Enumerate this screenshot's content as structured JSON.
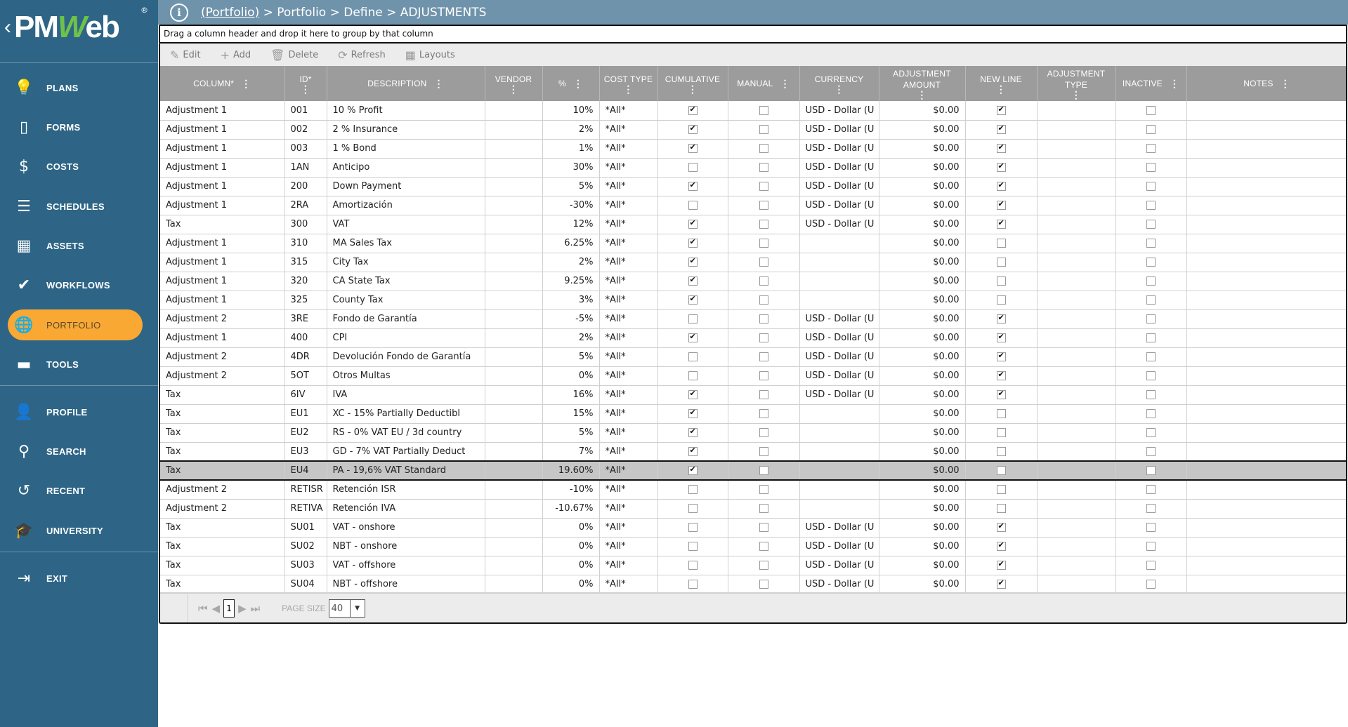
{
  "app": {
    "logo_text_pm": "PM",
    "logo_text_w": "W",
    "logo_text_eb": "eb",
    "logo_reg": "®",
    "logo_chevron": "‹"
  },
  "sidebar": {
    "items": [
      {
        "label": "PLANS",
        "icon": "lightbulb-icon",
        "glyph": "💡"
      },
      {
        "label": "FORMS",
        "icon": "document-icon",
        "glyph": "▯"
      },
      {
        "label": "COSTS",
        "icon": "dollar-icon",
        "glyph": "$"
      },
      {
        "label": "SCHEDULES",
        "icon": "gantt-icon",
        "glyph": "☰"
      },
      {
        "label": "ASSETS",
        "icon": "building-icon",
        "glyph": "▦"
      },
      {
        "label": "WORKFLOWS",
        "icon": "checkmark-icon",
        "glyph": "✔"
      },
      {
        "label": "PORTFOLIO",
        "icon": "globe-icon",
        "glyph": "🌐",
        "active": true
      },
      {
        "label": "TOOLS",
        "icon": "toolbox-icon",
        "glyph": "▬"
      },
      {
        "label": "PROFILE",
        "icon": "user-icon",
        "glyph": "👤"
      },
      {
        "label": "SEARCH",
        "icon": "search-icon",
        "glyph": "⚲"
      },
      {
        "label": "RECENT",
        "icon": "history-icon",
        "glyph": "↺"
      },
      {
        "label": "UNIVERSITY",
        "icon": "graduation-cap-icon",
        "glyph": "🎓"
      },
      {
        "label": "EXIT",
        "icon": "exit-icon",
        "glyph": "⇥"
      }
    ]
  },
  "header": {
    "info_glyph": "i",
    "breadcrumb_link": "(Portfolio)",
    "breadcrumb_rest": " > Portfolio > Define > ADJUSTMENTS"
  },
  "groupbar": {
    "text": "Drag a column header and drop it here to group by that column"
  },
  "toolbar": {
    "edit_label": "Edit",
    "add_label": "Add",
    "delete_label": "Delete",
    "refresh_label": "Refresh",
    "layouts_label": "Layouts"
  },
  "grid": {
    "columns": [
      {
        "label": "COLUMN*"
      },
      {
        "label": "ID*"
      },
      {
        "label": "DESCRIPTION"
      },
      {
        "label": "VENDOR"
      },
      {
        "label": "%"
      },
      {
        "label": "COST TYPE"
      },
      {
        "label": "CUMULATIVE"
      },
      {
        "label": "MANUAL"
      },
      {
        "label": "CURRENCY"
      },
      {
        "label": "ADJUSTMENT AMOUNT"
      },
      {
        "label": "NEW LINE"
      },
      {
        "label": "ADJUSTMENT TYPE"
      },
      {
        "label": "INACTIVE"
      },
      {
        "label": "NOTES"
      }
    ],
    "rows": [
      {
        "column": "Adjustment 1",
        "id": "001",
        "description": "10 % Profit",
        "vendor": "",
        "percent": "10%",
        "cost_type": "*All*",
        "cumulative": true,
        "manual": false,
        "currency": "USD - Dollar (U",
        "amount": "$0.00",
        "new_line": true,
        "adj_type": "",
        "inactive": false,
        "notes": ""
      },
      {
        "column": "Adjustment 1",
        "id": "002",
        "description": "2 % Insurance",
        "vendor": "",
        "percent": "2%",
        "cost_type": "*All*",
        "cumulative": true,
        "manual": false,
        "currency": "USD - Dollar (U",
        "amount": "$0.00",
        "new_line": true,
        "adj_type": "",
        "inactive": false,
        "notes": ""
      },
      {
        "column": "Adjustment 1",
        "id": "003",
        "description": "1 % Bond",
        "vendor": "",
        "percent": "1%",
        "cost_type": "*All*",
        "cumulative": true,
        "manual": false,
        "currency": "USD - Dollar (U",
        "amount": "$0.00",
        "new_line": true,
        "adj_type": "",
        "inactive": false,
        "notes": ""
      },
      {
        "column": "Adjustment 1",
        "id": "1AN",
        "description": "Anticipo",
        "vendor": "",
        "percent": "30%",
        "cost_type": "*All*",
        "cumulative": false,
        "manual": false,
        "currency": "USD - Dollar (U",
        "amount": "$0.00",
        "new_line": true,
        "adj_type": "",
        "inactive": false,
        "notes": ""
      },
      {
        "column": "Adjustment 1",
        "id": "200",
        "description": "Down Payment",
        "vendor": "",
        "percent": "5%",
        "cost_type": "*All*",
        "cumulative": true,
        "manual": false,
        "currency": "USD - Dollar (U",
        "amount": "$0.00",
        "new_line": true,
        "adj_type": "",
        "inactive": false,
        "notes": ""
      },
      {
        "column": "Adjustment 1",
        "id": "2RA",
        "description": "Amortización",
        "vendor": "",
        "percent": "-30%",
        "cost_type": "*All*",
        "cumulative": false,
        "manual": false,
        "currency": "USD - Dollar (U",
        "amount": "$0.00",
        "new_line": true,
        "adj_type": "",
        "inactive": false,
        "notes": ""
      },
      {
        "column": "Tax",
        "id": "300",
        "description": "VAT",
        "vendor": "",
        "percent": "12%",
        "cost_type": "*All*",
        "cumulative": true,
        "manual": false,
        "currency": "USD - Dollar (U",
        "amount": "$0.00",
        "new_line": true,
        "adj_type": "",
        "inactive": false,
        "notes": ""
      },
      {
        "column": "Adjustment 1",
        "id": "310",
        "description": "MA Sales Tax",
        "vendor": "",
        "percent": "6.25%",
        "cost_type": "*All*",
        "cumulative": true,
        "manual": false,
        "currency": "",
        "amount": "$0.00",
        "new_line": false,
        "adj_type": "",
        "inactive": false,
        "notes": ""
      },
      {
        "column": "Adjustment 1",
        "id": "315",
        "description": "City Tax",
        "vendor": "",
        "percent": "2%",
        "cost_type": "*All*",
        "cumulative": true,
        "manual": false,
        "currency": "",
        "amount": "$0.00",
        "new_line": false,
        "adj_type": "",
        "inactive": false,
        "notes": ""
      },
      {
        "column": "Adjustment 1",
        "id": "320",
        "description": "CA State Tax",
        "vendor": "",
        "percent": "9.25%",
        "cost_type": "*All*",
        "cumulative": true,
        "manual": false,
        "currency": "",
        "amount": "$0.00",
        "new_line": false,
        "adj_type": "",
        "inactive": false,
        "notes": ""
      },
      {
        "column": "Adjustment 1",
        "id": "325",
        "description": "County Tax",
        "vendor": "",
        "percent": "3%",
        "cost_type": "*All*",
        "cumulative": true,
        "manual": false,
        "currency": "",
        "amount": "$0.00",
        "new_line": false,
        "adj_type": "",
        "inactive": false,
        "notes": ""
      },
      {
        "column": "Adjustment 2",
        "id": "3RE",
        "description": "Fondo de Garantía",
        "vendor": "",
        "percent": "-5%",
        "cost_type": "*All*",
        "cumulative": false,
        "manual": false,
        "currency": "USD - Dollar (U",
        "amount": "$0.00",
        "new_line": true,
        "adj_type": "",
        "inactive": false,
        "notes": ""
      },
      {
        "column": "Adjustment 1",
        "id": "400",
        "description": "CPI",
        "vendor": "",
        "percent": "2%",
        "cost_type": "*All*",
        "cumulative": true,
        "manual": false,
        "currency": "USD - Dollar (U",
        "amount": "$0.00",
        "new_line": true,
        "adj_type": "",
        "inactive": false,
        "notes": ""
      },
      {
        "column": "Adjustment 2",
        "id": "4DR",
        "description": "Devolución Fondo de Garantía",
        "vendor": "",
        "percent": "5%",
        "cost_type": "*All*",
        "cumulative": false,
        "manual": false,
        "currency": "USD - Dollar (U",
        "amount": "$0.00",
        "new_line": true,
        "adj_type": "",
        "inactive": false,
        "notes": ""
      },
      {
        "column": "Adjustment 2",
        "id": "5OT",
        "description": "Otros Multas",
        "vendor": "",
        "percent": "0%",
        "cost_type": "*All*",
        "cumulative": false,
        "manual": false,
        "currency": "USD - Dollar (U",
        "amount": "$0.00",
        "new_line": true,
        "adj_type": "",
        "inactive": false,
        "notes": ""
      },
      {
        "column": "Tax",
        "id": "6IV",
        "description": "IVA",
        "vendor": "",
        "percent": "16%",
        "cost_type": "*All*",
        "cumulative": true,
        "manual": false,
        "currency": "USD - Dollar (U",
        "amount": "$0.00",
        "new_line": true,
        "adj_type": "",
        "inactive": false,
        "notes": ""
      },
      {
        "column": "Tax",
        "id": "EU1",
        "description": "XC - 15% Partially Deductibl",
        "vendor": "",
        "percent": "15%",
        "cost_type": "*All*",
        "cumulative": true,
        "manual": false,
        "currency": "",
        "amount": "$0.00",
        "new_line": false,
        "adj_type": "",
        "inactive": false,
        "notes": ""
      },
      {
        "column": "Tax",
        "id": "EU2",
        "description": "RS - 0% VAT EU / 3d country",
        "vendor": "",
        "percent": "5%",
        "cost_type": "*All*",
        "cumulative": true,
        "manual": false,
        "currency": "",
        "amount": "$0.00",
        "new_line": false,
        "adj_type": "",
        "inactive": false,
        "notes": ""
      },
      {
        "column": "Tax",
        "id": "EU3",
        "description": "GD - 7% VAT Partially Deduct",
        "vendor": "",
        "percent": "7%",
        "cost_type": "*All*",
        "cumulative": true,
        "manual": false,
        "currency": "",
        "amount": "$0.00",
        "new_line": false,
        "adj_type": "",
        "inactive": false,
        "notes": ""
      },
      {
        "column": "Tax",
        "id": "EU4",
        "description": "PA - 19,6% VAT Standard",
        "vendor": "",
        "percent": "19.60%",
        "cost_type": "*All*",
        "cumulative": true,
        "manual": false,
        "currency": "",
        "amount": "$0.00",
        "new_line": false,
        "adj_type": "",
        "inactive": false,
        "notes": "",
        "selected": true
      },
      {
        "column": "Adjustment 2",
        "id": "RETISR",
        "description": "Retención ISR",
        "vendor": "",
        "percent": "-10%",
        "cost_type": "*All*",
        "cumulative": false,
        "manual": false,
        "currency": "",
        "amount": "$0.00",
        "new_line": false,
        "adj_type": "",
        "inactive": false,
        "notes": ""
      },
      {
        "column": "Adjustment 2",
        "id": "RETIVA",
        "description": "Retención IVA",
        "vendor": "",
        "percent": "-10.67%",
        "cost_type": "*All*",
        "cumulative": false,
        "manual": false,
        "currency": "",
        "amount": "$0.00",
        "new_line": false,
        "adj_type": "",
        "inactive": false,
        "notes": ""
      },
      {
        "column": "Tax",
        "id": "SU01",
        "description": "VAT - onshore",
        "vendor": "",
        "percent": "0%",
        "cost_type": "*All*",
        "cumulative": false,
        "manual": false,
        "currency": "USD - Dollar (U",
        "amount": "$0.00",
        "new_line": true,
        "adj_type": "",
        "inactive": false,
        "notes": ""
      },
      {
        "column": "Tax",
        "id": "SU02",
        "description": "NBT - onshore",
        "vendor": "",
        "percent": "0%",
        "cost_type": "*All*",
        "cumulative": false,
        "manual": false,
        "currency": "USD - Dollar (U",
        "amount": "$0.00",
        "new_line": true,
        "adj_type": "",
        "inactive": false,
        "notes": ""
      },
      {
        "column": "Tax",
        "id": "SU03",
        "description": "VAT - offshore",
        "vendor": "",
        "percent": "0%",
        "cost_type": "*All*",
        "cumulative": false,
        "manual": false,
        "currency": "USD - Dollar (U",
        "amount": "$0.00",
        "new_line": true,
        "adj_type": "",
        "inactive": false,
        "notes": ""
      },
      {
        "column": "Tax",
        "id": "SU04",
        "description": "NBT - offshore",
        "vendor": "",
        "percent": "0%",
        "cost_type": "*All*",
        "cumulative": false,
        "manual": false,
        "currency": "USD - Dollar (U",
        "amount": "$0.00",
        "new_line": true,
        "adj_type": "",
        "inactive": false,
        "notes": ""
      }
    ]
  },
  "pager": {
    "current_page": "1",
    "page_size_label": "PAGE SIZE",
    "page_size": "40"
  }
}
